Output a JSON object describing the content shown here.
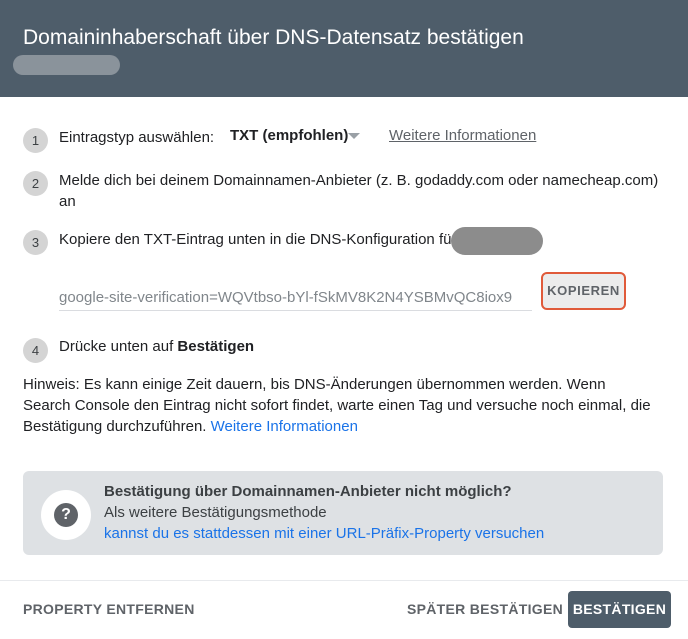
{
  "dialog": {
    "title": "Domaininhaberschaft über DNS-Datensatz bestätigen"
  },
  "steps": [
    {
      "number": "1",
      "label": "Eintragstyp auswählen:",
      "select_value": "TXT (empfohlen)",
      "link": "Weitere Informationen"
    },
    {
      "number": "2",
      "line1": "Melde dich bei deinem Domainnamen-Anbieter (z. B. godaddy.com oder namecheap.com)",
      "line2": "an"
    },
    {
      "number": "3",
      "text": "Kopiere den TXT-Eintrag unten in die DNS-Konfiguration für",
      "txt_record": "google-site-verification=WQVtbso-bYl-fSkMV8K2N4YSBMvQC8iox9",
      "copy_label": "KOPIEREN"
    },
    {
      "number": "4",
      "text_prefix": "Drücke unten auf ",
      "text_bold": "Bestätigen"
    }
  ],
  "hint": {
    "text": "Hinweis: Es kann einige Zeit dauern, bis DNS-Änderungen übernommen werden. Wenn Search Console den Eintrag nicht sofort findet, warte einen Tag und versuche noch einmal, die Bestätigung durchzuführen. ",
    "link": "Weitere Informationen"
  },
  "callout": {
    "icon": "help-icon",
    "title": "Bestätigung über Domainnamen-Anbieter nicht möglich?",
    "line2": "Als weitere Bestätigungsmethode",
    "link": "kannst du es stattdessen mit einer URL-Präfix-Property versuchen"
  },
  "footer": {
    "remove_label": "PROPERTY ENTFERNEN",
    "later_label": "SPÄTER BESTÄTIGEN",
    "confirm_label": "BESTÄTIGEN"
  },
  "colors": {
    "header_bg": "#4e5d6a",
    "link_blue": "#1a73e8",
    "copy_highlight": "#e05a3a"
  }
}
